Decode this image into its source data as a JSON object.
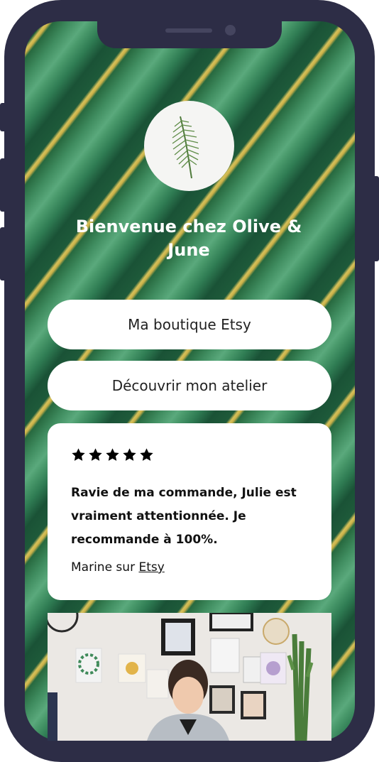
{
  "profile": {
    "welcome_title": "Bienvenue chez Olive & June",
    "avatar_icon": "palm-leaf-icon"
  },
  "links": [
    {
      "label": "Ma boutique Etsy"
    },
    {
      "label": "Découvrir mon atelier"
    }
  ],
  "review": {
    "rating": 5,
    "text": "Ravie de ma commande, Julie est vraiment attentionnée. Je recommande à 100%.",
    "author_prefix": "Marine sur ",
    "source_link": "Etsy"
  },
  "colors": {
    "frame": "#2d2d46",
    "card": "#ffffff",
    "leaf_green": "#2f7c53",
    "leaf_yellow": "#d6c15a"
  }
}
